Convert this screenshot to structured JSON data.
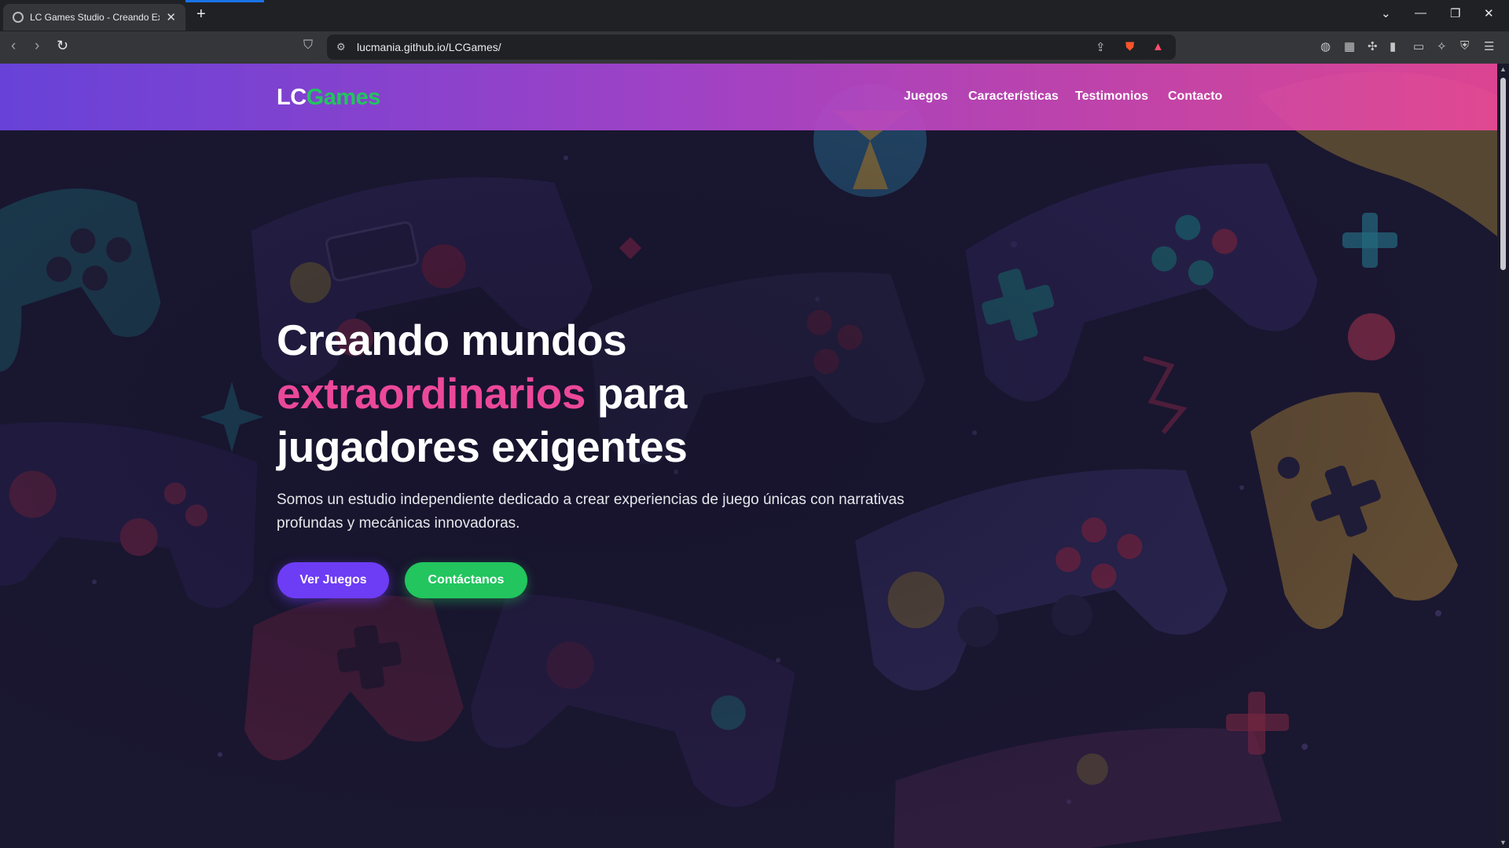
{
  "browser": {
    "tab_title": "LC Games Studio - Creando Exp",
    "tab_close": "✕",
    "new_tab": "+",
    "url": "lucmania.github.io/LCGames/",
    "icons": {
      "back": "back-icon",
      "forward": "forward-icon",
      "reload": "reload-icon",
      "bookmark": "bookmark-icon",
      "site_info": "site-info-icon",
      "share": "share-icon",
      "brave_shields": "brave-shields-icon",
      "brave_rewards": "brave-rewards-icon",
      "tab_search": "tab-search-icon",
      "minimize": "minimize-icon",
      "restore": "restore-icon",
      "close": "close-icon",
      "menu": "menu-icon"
    }
  },
  "header": {
    "logo_lc": "LC",
    "logo_games": "Games",
    "nav": [
      "Juegos",
      "Características",
      "Testimonios",
      "Contacto"
    ]
  },
  "hero": {
    "title_line1": "Creando mundos",
    "title_highlight": "extraordinarios",
    "title_after_highlight": " para",
    "title_line3": "jugadores exigentes",
    "subtitle": "Somos un estudio independiente dedicado a crear experiencias de juego únicas con narrativas profundas y mecánicas innovadoras.",
    "btn_games": "Ver Juegos",
    "btn_contact": "Contáctanos"
  },
  "colors": {
    "accent_purple": "#6d3cf5",
    "accent_green": "#22c55e",
    "accent_pink": "#ec4899",
    "page_background": "#1b1933"
  }
}
